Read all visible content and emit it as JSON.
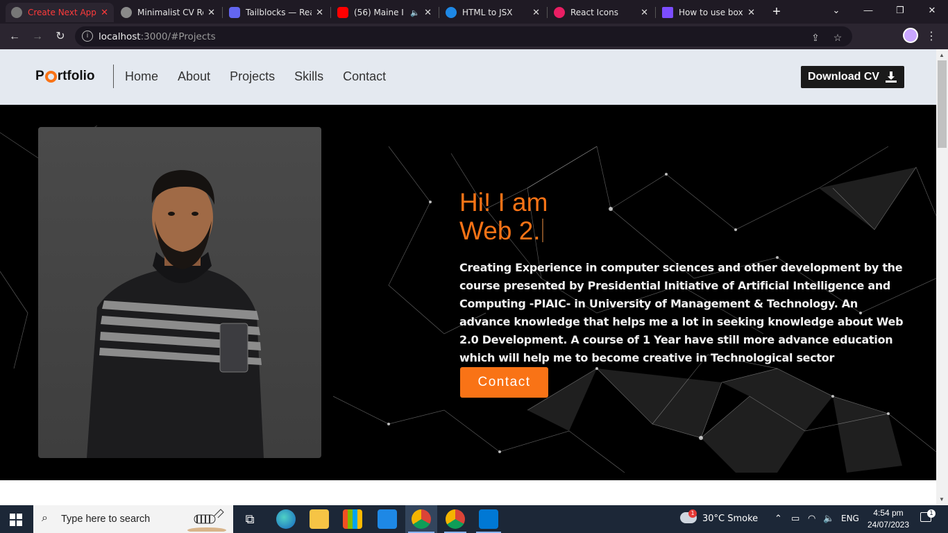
{
  "browser": {
    "tabs": [
      {
        "title": "Create Next App",
        "active": true
      },
      {
        "title": "Minimalist CV Re",
        "active": false
      },
      {
        "title": "Tailblocks — Rea",
        "active": false
      },
      {
        "title": "(56) Maine I",
        "active": false
      },
      {
        "title": "HTML to JSX",
        "active": false
      },
      {
        "title": "React Icons",
        "active": false
      },
      {
        "title": "How to use box",
        "active": false
      }
    ],
    "url_host": "localhost",
    "url_rest": ":3000/#Projects"
  },
  "site": {
    "logo_prefix": "P",
    "logo_suffix": "rtfolio",
    "nav": [
      {
        "label": "Home"
      },
      {
        "label": "About"
      },
      {
        "label": "Projects"
      },
      {
        "label": "Skills"
      },
      {
        "label": "Contact"
      }
    ],
    "download_label": "Download CV"
  },
  "hero": {
    "line1": "Hi! I am",
    "line2": "Web 2.",
    "description": "Creating Experience in computer sciences and other development by the course presented by Presidential Initiative of Artificial Intelligence and Computing -PIAIC- in University of Management & Technology. An advance knowledge that helps me a lot in seeking knowledge about Web 2.0 Development. A course of 1 Year have still more advance education which will help me to become creative in Technological sector",
    "contact_label": "Contact"
  },
  "taskbar": {
    "search_placeholder": "Type here to search",
    "weather_badge": "1",
    "weather": "30°C  Smoke",
    "language": "ENG",
    "time": "4:54 pm",
    "date": "24/07/2023",
    "notification_count": "1"
  },
  "colors": {
    "accent": "#f97316",
    "nav_bg": "#e4e9f0",
    "hero_bg": "#000000"
  }
}
